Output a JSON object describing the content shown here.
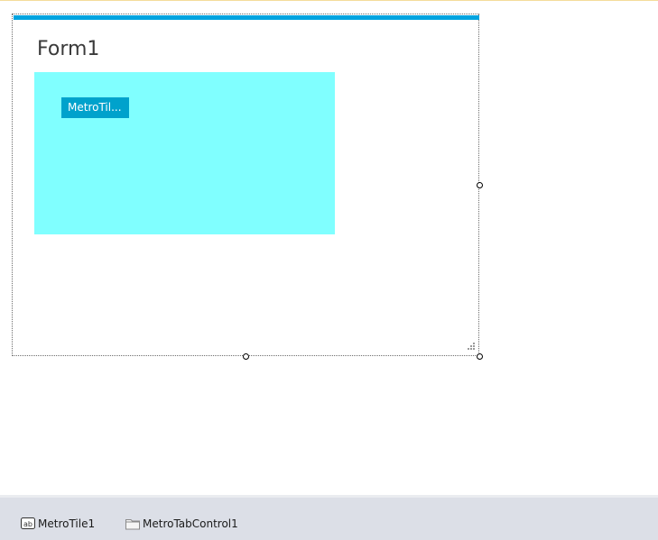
{
  "form": {
    "title": "Form1",
    "accent_color": "#00a4e0"
  },
  "tab_control": {
    "background_color": "#80ffff"
  },
  "metro_tile": {
    "label": "MetroTil...",
    "background_color": "#00a2cc"
  },
  "component_tray": {
    "items": [
      {
        "label": "MetroTile1",
        "icon": "textbox-icon"
      },
      {
        "label": "MetroTabControl1",
        "icon": "folder-icon"
      }
    ]
  }
}
